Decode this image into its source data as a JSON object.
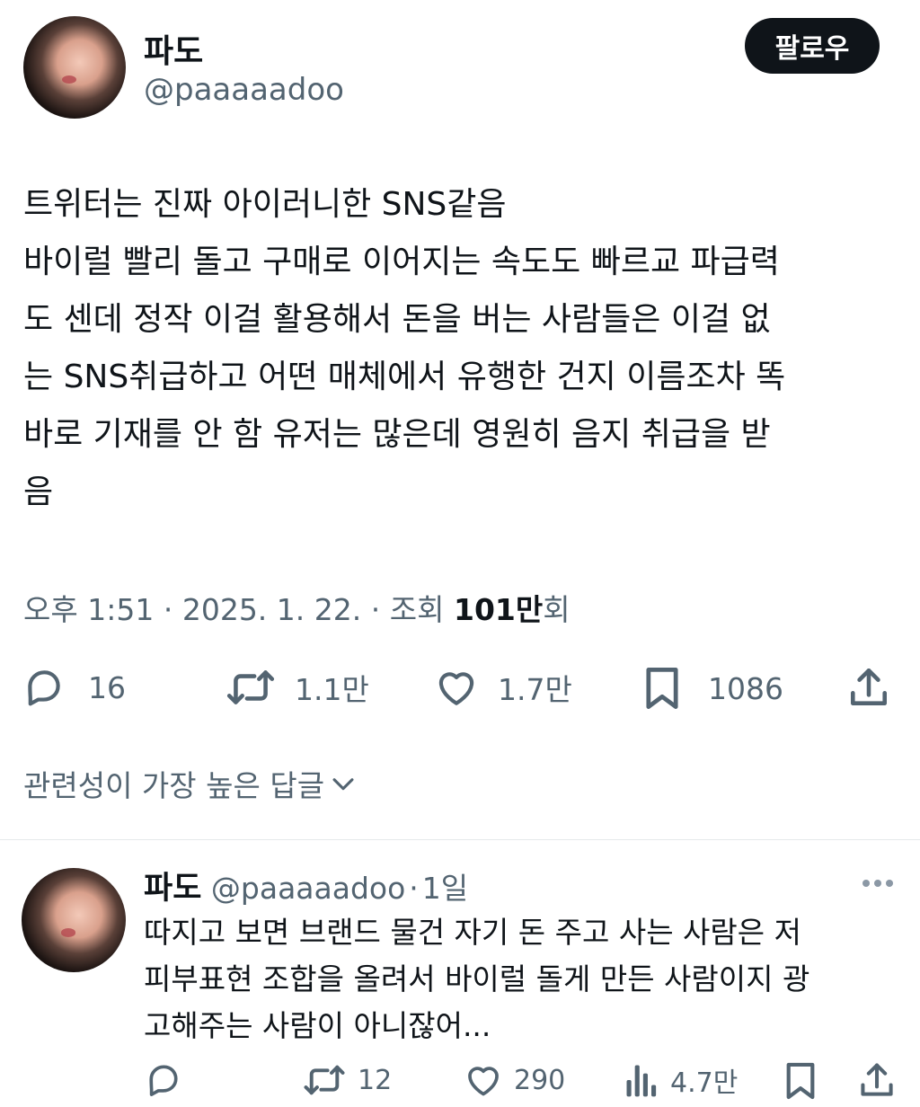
{
  "tweet": {
    "author_name": "파도",
    "author_handle": "@paaaaadoo",
    "follow_label": "팔로우",
    "text_lines": [
      "트위터는 진짜 아이러니한 SNS같음",
      "바이럴 빨리 돌고 구매로 이어지는 속도도 빠르교 파급력",
      "도 센데 정작 이걸 활용해서 돈을 버는 사람들은 이걸 없",
      "는 SNS취급하고 어떤 매체에서 유행한 건지 이름조차 똑",
      "바로 기재를 안 함 유저는 많은데 영원히 음지 취급을 받",
      "음"
    ],
    "time": "오후 1:51",
    "date": "2025. 1. 22.",
    "views_label": "조회",
    "views_count": "101만",
    "views_suffix": "회",
    "separator": "·",
    "stats": {
      "replies": "16",
      "retweets": "1.1만",
      "likes": "1.7만",
      "bookmarks": "1086"
    }
  },
  "replies_sort_label": "관련성이 가장 높은 답글",
  "reply": {
    "author_name": "파도",
    "author_handle": "@paaaaadoo",
    "time_ago": "1일",
    "separator": "·",
    "text_lines": [
      "따지고 보면 브랜드 물건 자기 돈 주고 사는 사람은 저",
      "피부표현 조합을 올려서 바이럴 돌게 만든 사람이지 광",
      "고해주는 사람이 아니잖어..."
    ],
    "stats": {
      "retweets": "12",
      "likes": "290",
      "views": "4.7만"
    }
  },
  "colors": {
    "text": "#0f1419",
    "secondary": "#536471",
    "button_bg": "#0f1419",
    "button_text": "#ffffff",
    "divider": "#e6e9eb"
  },
  "icons": [
    "reply-icon",
    "retweet-icon",
    "like-icon",
    "bookmark-icon",
    "share-icon",
    "views-icon",
    "more-icon",
    "chevron-down-icon"
  ]
}
